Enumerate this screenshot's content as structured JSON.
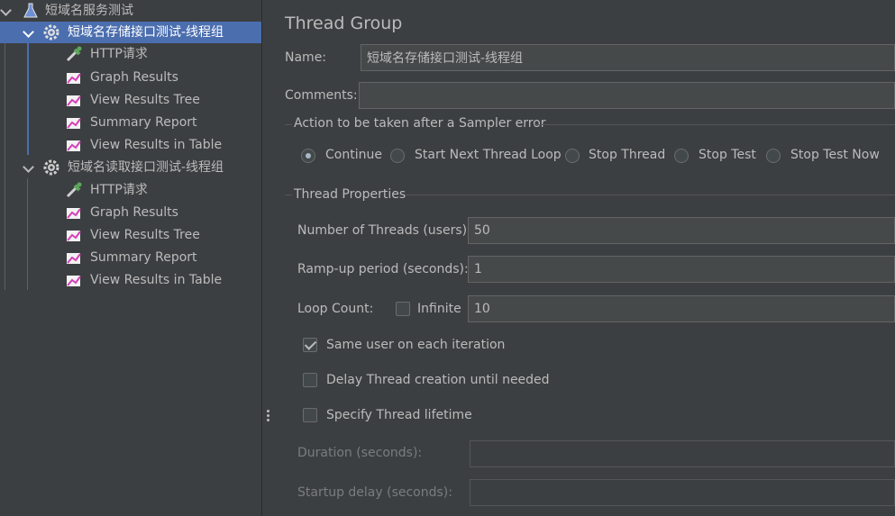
{
  "tree": {
    "test_plan": "短域名服务测试",
    "groups": [
      {
        "label": "短域名存储接口测试-线程组",
        "children": [
          "HTTP请求",
          "Graph Results",
          "View Results Tree",
          "Summary Report",
          "View Results in Table"
        ]
      },
      {
        "label": "短域名读取接口测试-线程组",
        "children": [
          "HTTP请求",
          "Graph Results",
          "View Results Tree",
          "Summary Report",
          "View Results in Table"
        ]
      }
    ]
  },
  "panel": {
    "title": "Thread Group",
    "name_label": "Name:",
    "name_value": "短域名存储接口测试-线程组",
    "comments_label": "Comments:",
    "comments_value": "",
    "sampler_error": {
      "legend": "Action to be taken after a Sampler error",
      "options": [
        "Continue",
        "Start Next Thread Loop",
        "Stop Thread",
        "Stop Test",
        "Stop Test Now"
      ],
      "selected": "Continue"
    },
    "thread_props": {
      "legend": "Thread Properties",
      "threads_label": "Number of Threads (users):",
      "threads_value": "50",
      "rampup_label": "Ramp-up period (seconds):",
      "rampup_value": "1",
      "loop_label": "Loop Count:",
      "infinite_label": "Infinite",
      "infinite_checked": false,
      "loop_value": "10",
      "same_user_label": "Same user on each iteration",
      "same_user_checked": true,
      "delay_label": "Delay Thread creation until needed",
      "delay_checked": false,
      "lifetime_label": "Specify Thread lifetime",
      "lifetime_checked": false,
      "duration_label": "Duration (seconds):",
      "duration_value": "",
      "startup_label": "Startup delay (seconds):",
      "startup_value": ""
    }
  },
  "colors": {
    "background": "#3c3f41",
    "selection": "#4b6eaf",
    "field": "#45494a",
    "text": "#bbbbbb"
  }
}
